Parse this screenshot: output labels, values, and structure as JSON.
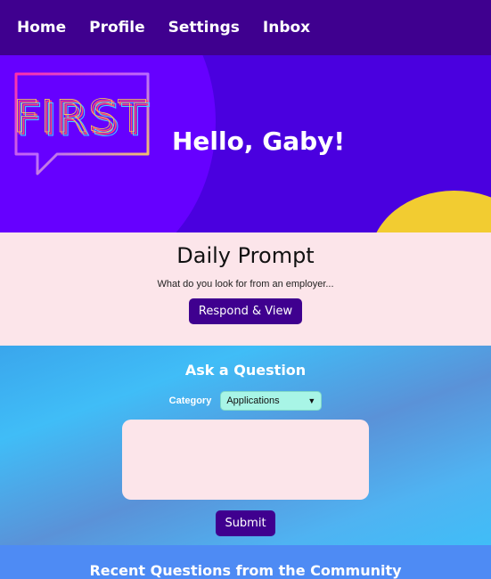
{
  "nav": {
    "items": [
      {
        "label": "Home"
      },
      {
        "label": "Profile"
      },
      {
        "label": "Settings"
      },
      {
        "label": "Inbox"
      }
    ]
  },
  "hero": {
    "logo_text": "FIRST",
    "greeting": "Hello, Gaby!",
    "colors": {
      "background": "#4a00df",
      "circle_left": "#6600ff",
      "circle_right": "#f2cc31"
    }
  },
  "daily_prompt": {
    "title": "Daily Prompt",
    "question": "What do you look for from an employer...",
    "button_label": "Respond & View"
  },
  "ask": {
    "title": "Ask a Question",
    "category_label": "Category",
    "category_value": "Applications",
    "text_value": "",
    "submit_label": "Submit"
  },
  "recent": {
    "title": "Recent Questions from the Community"
  }
}
